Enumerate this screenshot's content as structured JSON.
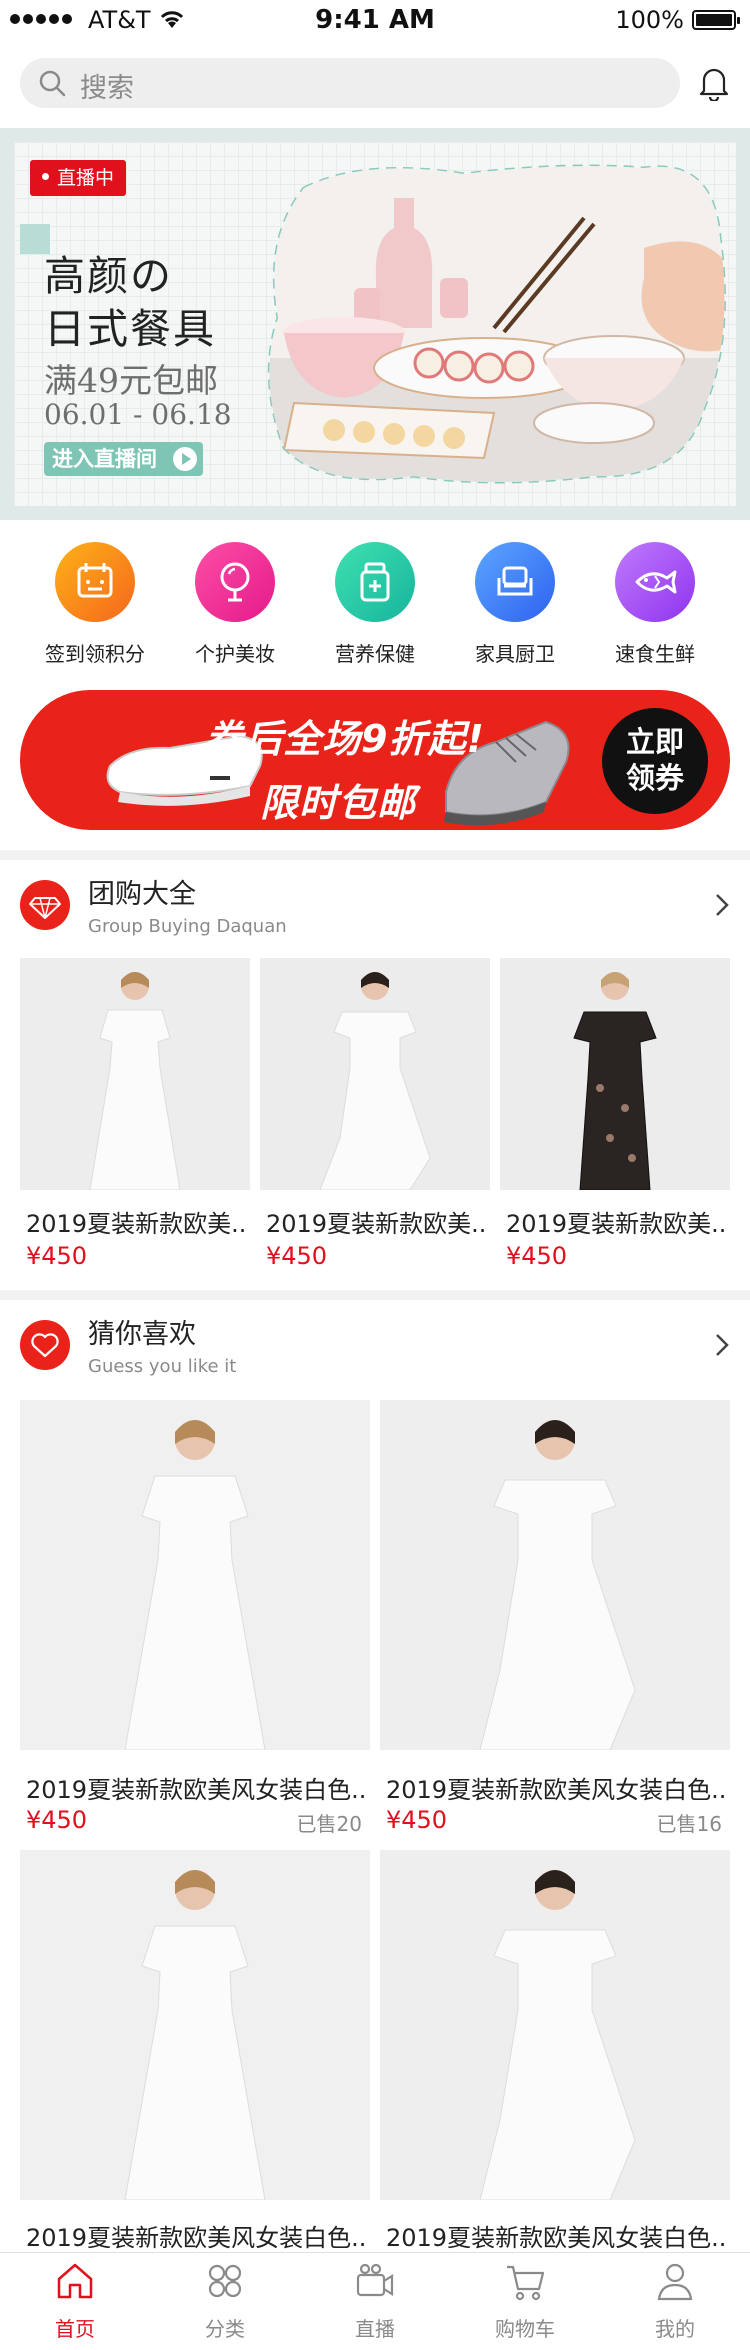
{
  "status_bar": {
    "carrier": "AT&T",
    "time": "9:41 AM",
    "battery": "100%"
  },
  "search": {
    "placeholder": "搜索"
  },
  "banner": {
    "badge": "直播中",
    "title_line1": "高颜の",
    "title_line2": "日式餐具",
    "subtitle": "满49元包邮",
    "date": "06.01 - 06.18",
    "cta": "进入直播间"
  },
  "categories": [
    {
      "label": "签到领积分",
      "icon": "calendar-icon",
      "color_from": "#fdb217",
      "color_to": "#f5671c"
    },
    {
      "label": "个护美妆",
      "icon": "mirror-icon",
      "color_from": "#fc4fa6",
      "color_to": "#e5198a"
    },
    {
      "label": "营养保健",
      "icon": "medicine-bottle-icon",
      "color_from": "#3fe1b1",
      "color_to": "#17b49c"
    },
    {
      "label": "家具厨卫",
      "icon": "sofa-icon",
      "color_from": "#5ba6ff",
      "color_to": "#2e62ef"
    },
    {
      "label": "速食生鲜",
      "icon": "fish-icon",
      "color_from": "#c07bfb",
      "color_to": "#8f33ee"
    }
  ],
  "promo": {
    "line1": "券后全场9折起!",
    "line2": "限时包邮",
    "cta_line1": "立即",
    "cta_line2": "领券"
  },
  "group_buy": {
    "title": "团购大全",
    "subtitle": "Group Buying Daquan",
    "items": [
      {
        "name": "2019夏装新款欧美...",
        "price": "¥450"
      },
      {
        "name": "2019夏装新款欧美...",
        "price": "¥450"
      },
      {
        "name": "2019夏装新款欧美...",
        "price": "¥450"
      }
    ]
  },
  "guess": {
    "title": "猜你喜欢",
    "subtitle": "Guess you like it",
    "items": [
      {
        "name": "2019夏装新款欧美风女装白色...",
        "price": "¥450",
        "sold": "已售20"
      },
      {
        "name": "2019夏装新款欧美风女装白色...",
        "price": "¥450",
        "sold": "已售16"
      },
      {
        "name": "2019夏装新款欧美风女装白色...",
        "price": "",
        "sold": ""
      },
      {
        "name": "2019夏装新款欧美风女装白色...",
        "price": "",
        "sold": ""
      }
    ]
  },
  "tabs": [
    {
      "label": "首页",
      "icon": "home-icon",
      "active": true
    },
    {
      "label": "分类",
      "icon": "category-icon",
      "active": false
    },
    {
      "label": "直播",
      "icon": "live-camera-icon",
      "active": false
    },
    {
      "label": "购物车",
      "icon": "cart-icon",
      "active": false
    },
    {
      "label": "我的",
      "icon": "profile-icon",
      "active": false
    }
  ],
  "colors": {
    "accent": "#e0101c",
    "promo_red": "#e9231a",
    "teal": "#7fc5b5"
  }
}
